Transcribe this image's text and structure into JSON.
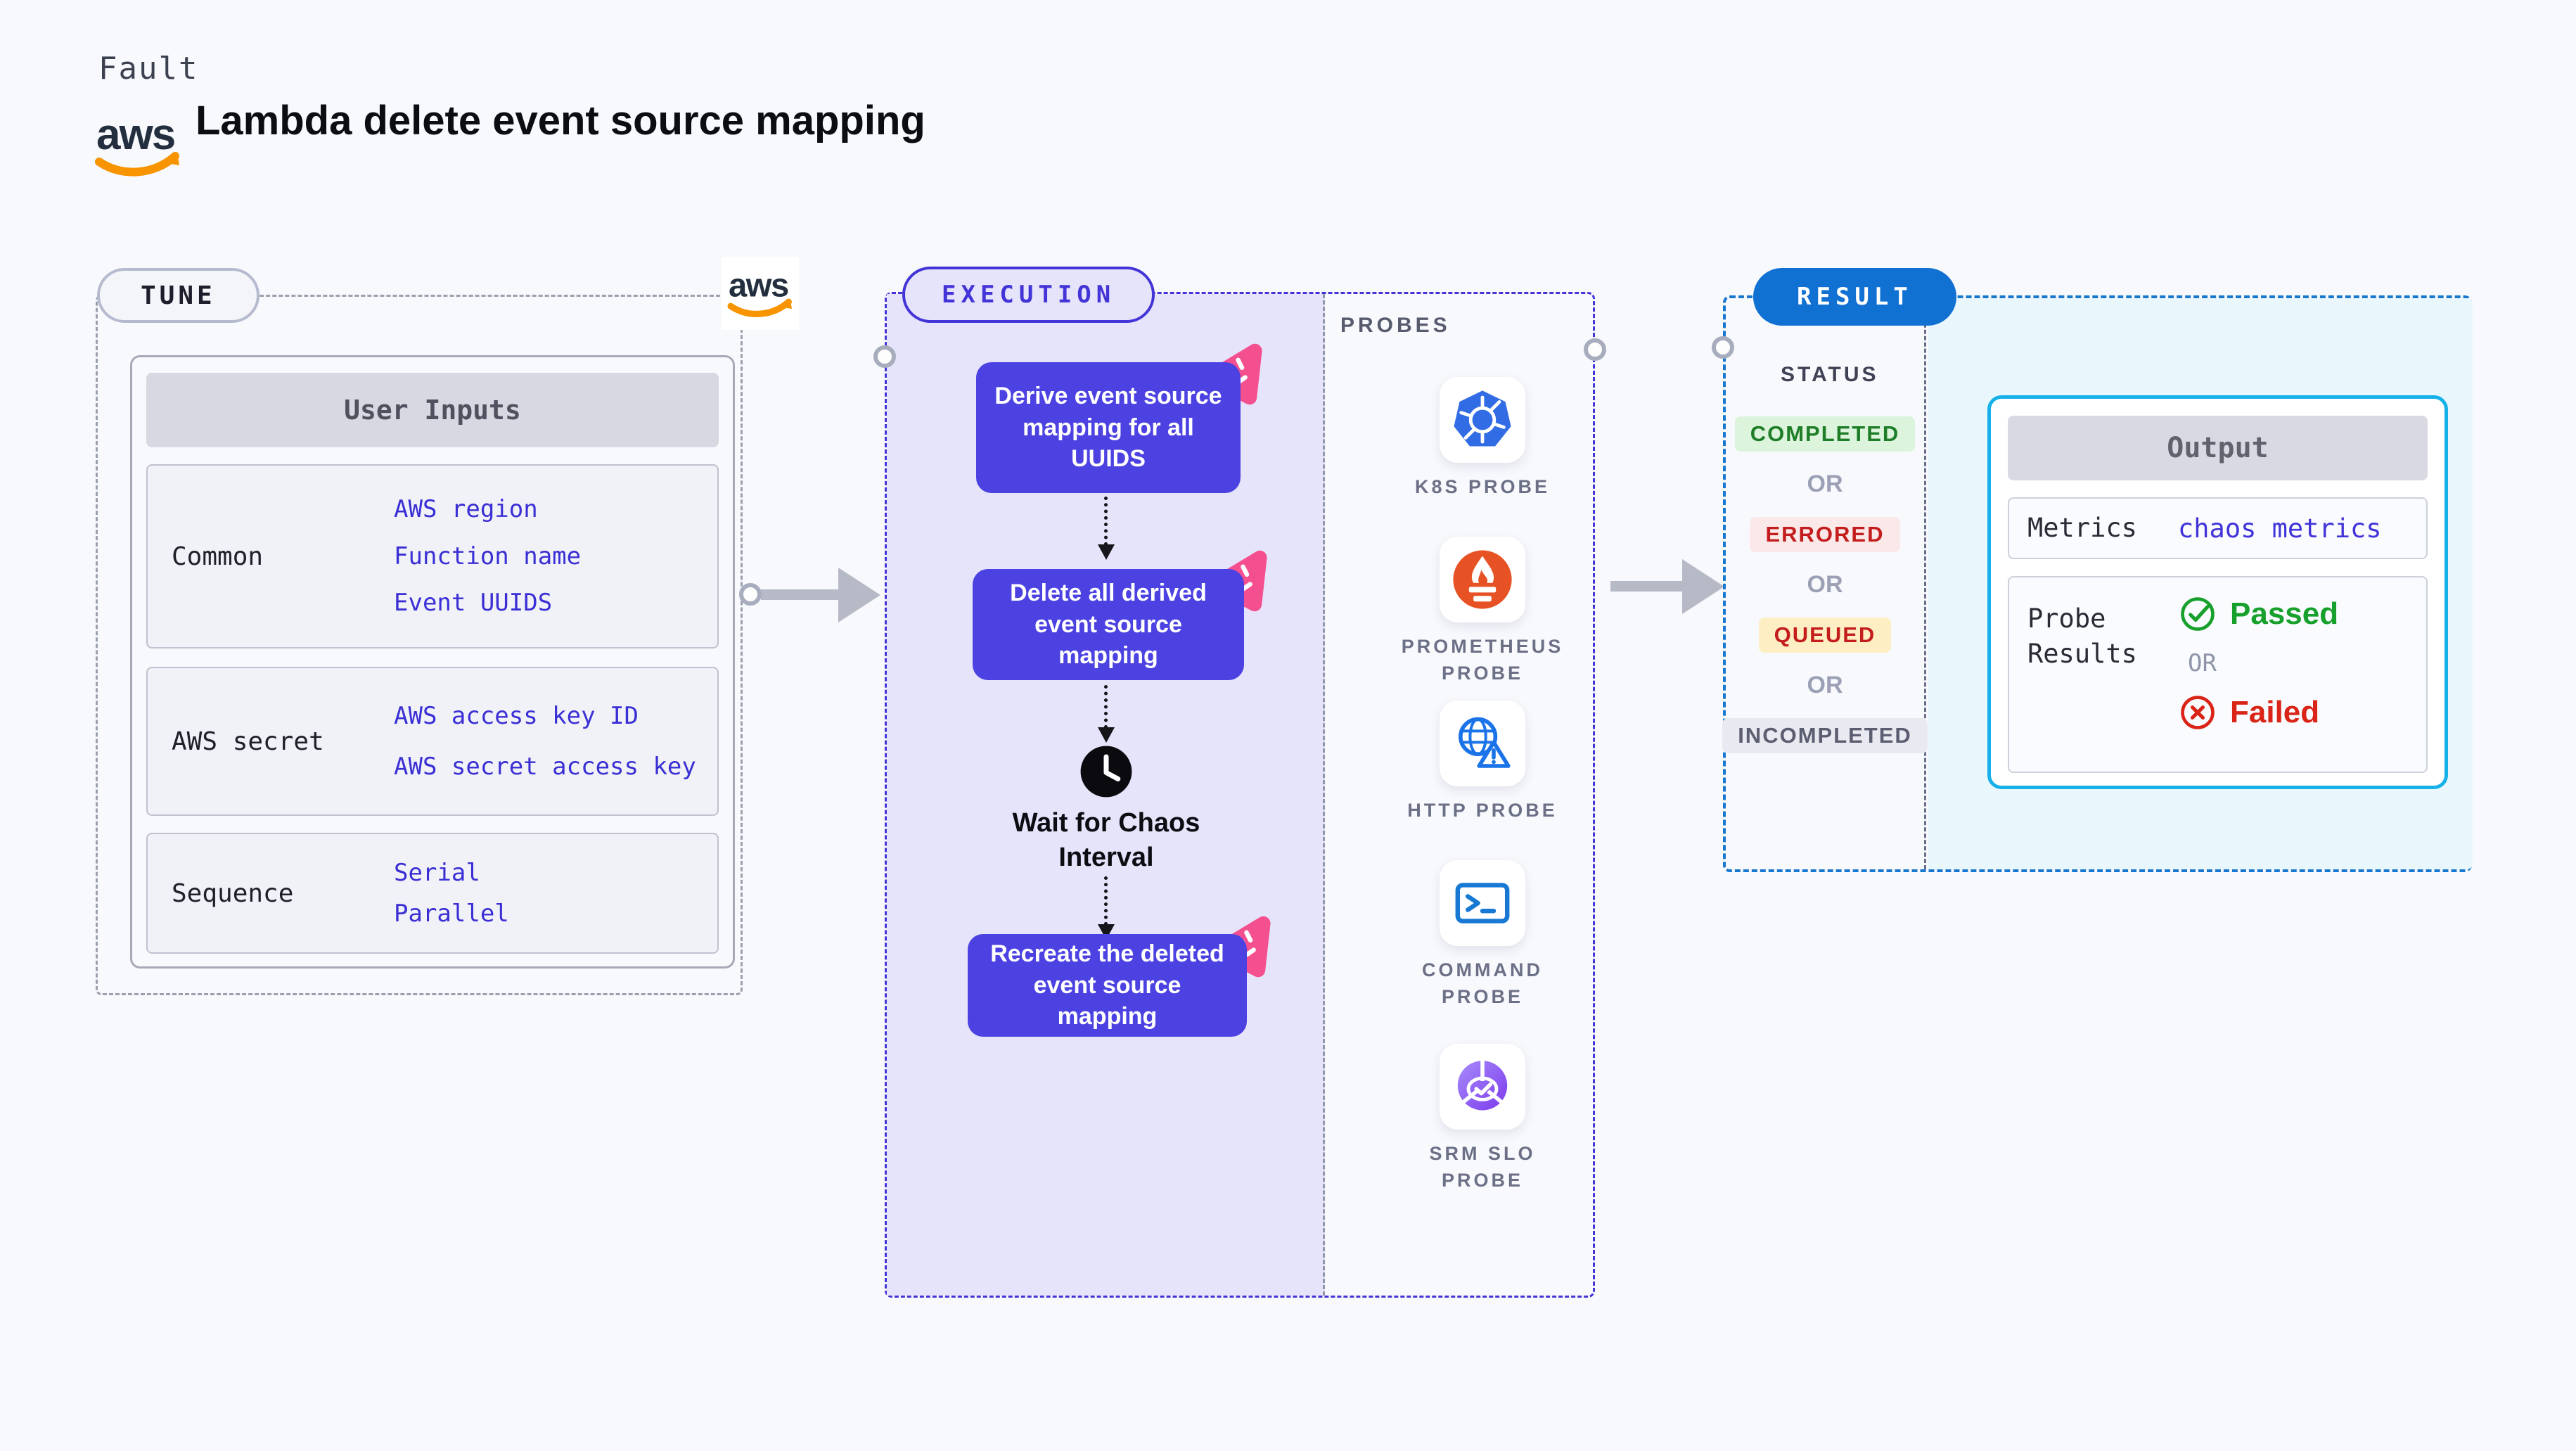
{
  "page": {
    "eyebrow": "Fault",
    "title": "Lambda delete event source mapping",
    "aws_logo_text": "aws"
  },
  "tune": {
    "label": "TUNE",
    "table": {
      "header": "User Inputs",
      "rows": [
        {
          "label": "Common",
          "values": [
            "AWS region",
            "Function name",
            "Event UUIDS"
          ]
        },
        {
          "label": "AWS secret",
          "values": [
            "AWS access key ID",
            "AWS secret access key"
          ]
        },
        {
          "label": "Sequence",
          "values": [
            "Serial",
            "Parallel"
          ]
        }
      ]
    }
  },
  "execution": {
    "label": "EXECUTION",
    "steps": [
      "Derive event source mapping for all UUIDS",
      "Delete all derived event source mapping",
      "Wait for Chaos Interval",
      "Recreate the deleted event source mapping"
    ]
  },
  "probes": {
    "label": "PROBES",
    "items": [
      {
        "name": "K8S PROBE",
        "icon": "kubernetes-icon"
      },
      {
        "name": "PROMETHEUS PROBE",
        "icon": "prometheus-icon"
      },
      {
        "name": "HTTP PROBE",
        "icon": "http-globe-warning-icon"
      },
      {
        "name": "COMMAND PROBE",
        "icon": "terminal-icon"
      },
      {
        "name": "SRM SLO PROBE",
        "icon": "slo-gauge-check-icon"
      }
    ]
  },
  "result": {
    "label": "RESULT",
    "status_label": "STATUS",
    "or_label": "OR",
    "statuses": [
      {
        "label": "COMPLETED",
        "fg": "#1e7e27",
        "bg": "#dcf3dc"
      },
      {
        "label": "ERRORED",
        "fg": "#c41d1d",
        "bg": "#fbe9e9"
      },
      {
        "label": "QUEUED",
        "fg": "#c41d1d",
        "bg": "#fdefc3"
      },
      {
        "label": "INCOMPLETED",
        "fg": "#5b5e70",
        "bg": "#e9eaf1"
      }
    ],
    "output": {
      "header": "Output",
      "metrics_label": "Metrics",
      "metrics_value": "chaos metrics",
      "probe_results_label": "Probe Results",
      "or_label": "OR",
      "passed_label": "Passed",
      "failed_label": "Failed"
    }
  },
  "colors": {
    "page_bg": "#f8f9fd",
    "accent_indigo": "#4334d8",
    "step_box_indigo": "#4c42e2",
    "execution_bg": "#e6e4fb",
    "result_blue": "#1171d2",
    "result_dashed_blue": "#1878d0",
    "output_border_cyan": "#16b1e9",
    "output_bg_cyan": "#e9f7fd",
    "chaos_pink": "#f4508f",
    "aws_orange": "#f79400",
    "passed_green": "#17a02c",
    "failed_red": "#d92417",
    "arrow_gray": "#b6bac7"
  }
}
